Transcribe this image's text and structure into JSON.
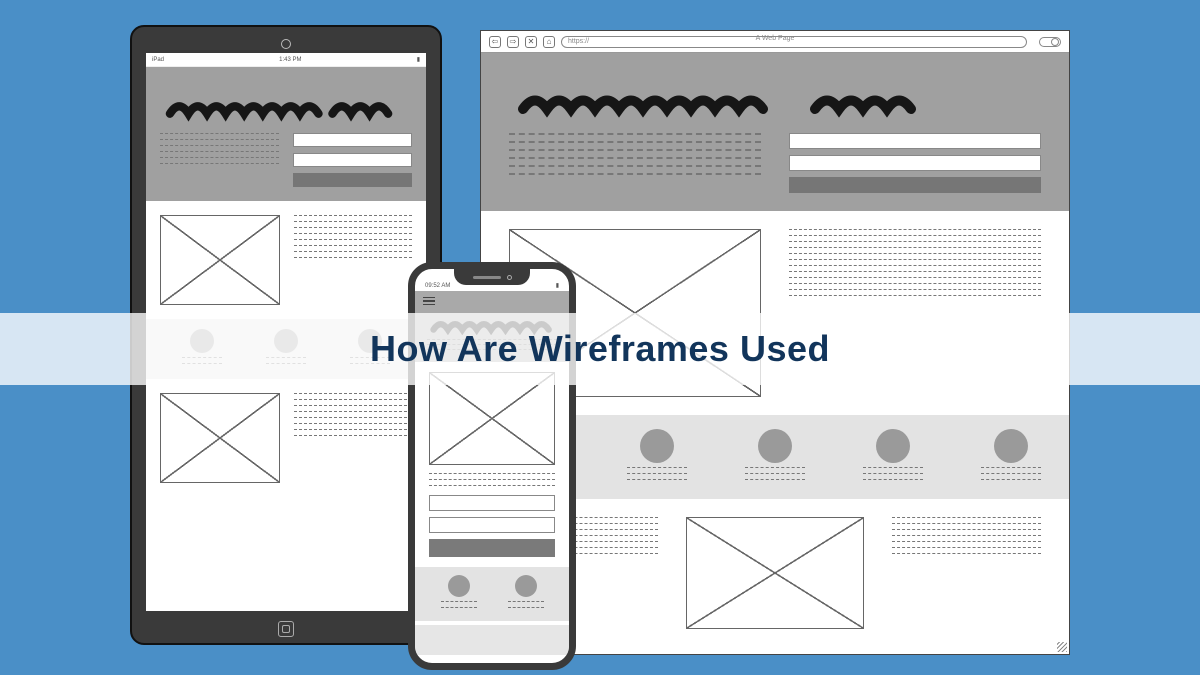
{
  "overlay": {
    "title": "How Are Wireframes Used"
  },
  "tablet": {
    "status_left": "iPad",
    "status_time": "1:43 PM"
  },
  "browser": {
    "title": "A Web Page",
    "url_prefix": "https://"
  },
  "phone": {
    "status_time": "09:52 AM"
  }
}
